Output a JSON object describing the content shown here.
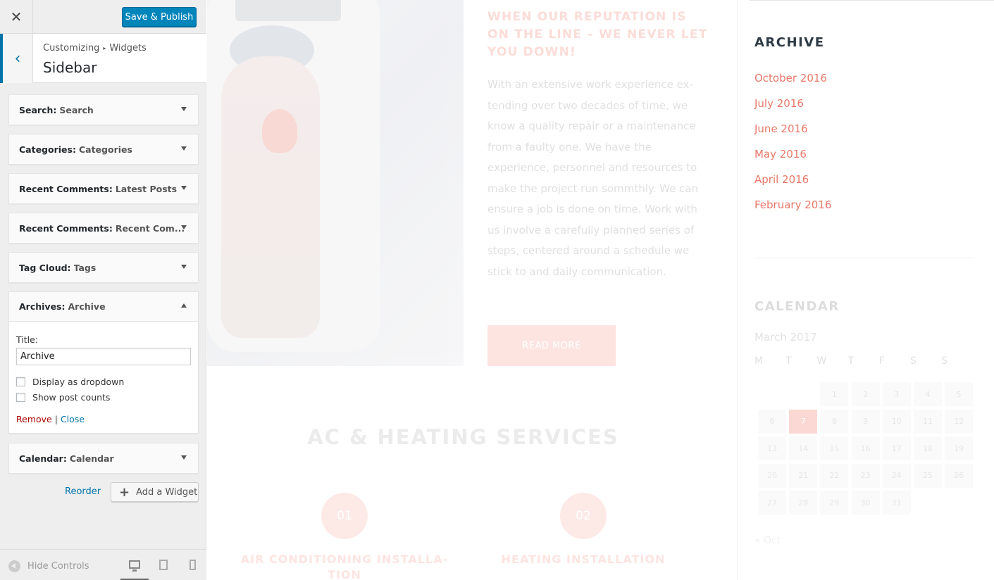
{
  "topbar": {
    "close_glyph": "✕",
    "publish_label": "Save & Publish"
  },
  "section": {
    "breadcrumb_root": "Customizing",
    "breadcrumb_sep": "▸",
    "breadcrumb_leaf": "Widgets",
    "title": "Sidebar",
    "back_glyph": "‹"
  },
  "widgets": [
    {
      "type": "Search:",
      "title": "Search"
    },
    {
      "type": "Categories:",
      "title": "Categories"
    },
    {
      "type": "Recent Comments:",
      "title": "Latest Posts"
    },
    {
      "type": "Recent Comments:",
      "title": "Recent Com..."
    },
    {
      "type": "Tag Cloud:",
      "title": "Tags"
    },
    {
      "type": "Archives:",
      "title": "Archive"
    },
    {
      "type": "Calendar:",
      "title": "Calendar"
    }
  ],
  "archive_form": {
    "title_label": "Title:",
    "title_value": "Archive",
    "dropdown_label": "Display as dropdown",
    "counts_label": "Show post counts",
    "remove_label": "Remove",
    "separator": "|",
    "close_label": "Close"
  },
  "panel_actions": {
    "reorder_label": "Reorder",
    "add_widget_label": "Add a Widget",
    "add_glyph": "+"
  },
  "footer": {
    "hide_controls_label": "Hide Controls",
    "active_device": "desktop",
    "device_icons": [
      "desktop-icon",
      "tablet-icon",
      "mobile-icon"
    ]
  },
  "preview": {
    "heading": "WHEN OUR REPUTATION IS ON THE LINE – WE NEVER LET YOU DOWN!",
    "body": "With an extensive work experience ex-tending over two decades of time, we know a quality repair or a maintenance from a faulty one. We have the experience, personnel and resources to make the project run sommthly. We can ensure a job is done on time. Work with us involve a carefully planned series of steps, centered around a schedule we stick to and daily communication.",
    "read_more": "READ MORE",
    "services_title": "AC & HEATING SERVICES",
    "service_1_number": "01",
    "service_1_title": "AIR CONDITIONING INSTALLA-TION",
    "service_2_number": "02",
    "service_2_title": "HEATING INSTALLATION",
    "archive_title": "ARCHIVE",
    "archive_links": [
      "October 2016",
      "July 2016",
      "June 2016",
      "May 2016",
      "April 2016",
      "February 2016"
    ],
    "calendar_title": "CALENDAR",
    "calendar_caption": "March 2017",
    "calendar_days": [
      "M",
      "T",
      "W",
      "T",
      "F",
      "S",
      "S"
    ],
    "calendar_today": "7",
    "calendar_prev": "« Oct",
    "accent_color": "#e8796a",
    "primary_button_color": "#0085ba"
  }
}
